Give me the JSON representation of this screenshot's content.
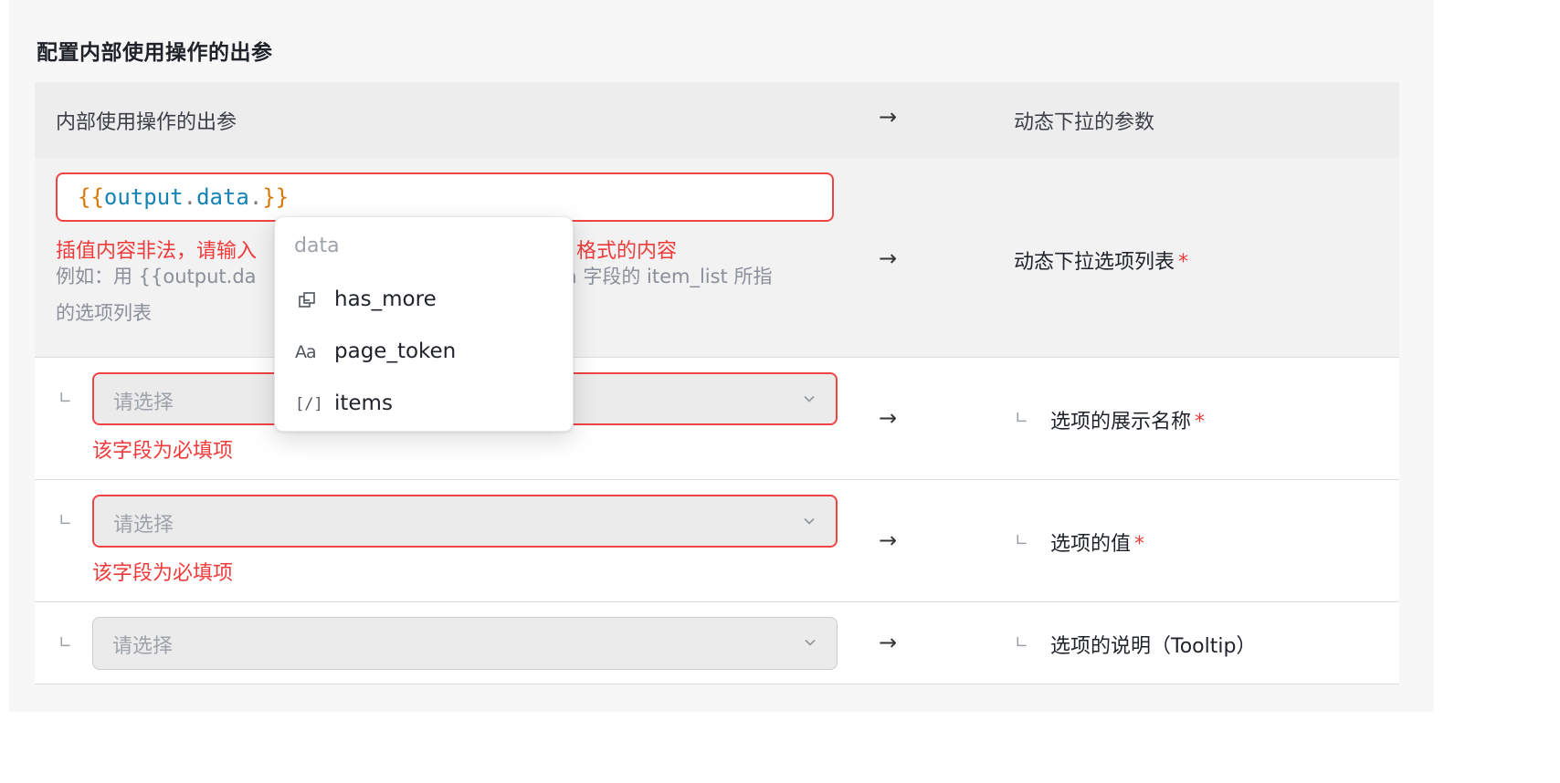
{
  "section_title": "配置内部使用操作的出参",
  "table": {
    "header_left": "内部使用操作的出参",
    "header_arrow": "→",
    "header_right": "动态下拉的参数"
  },
  "row_expression": {
    "input_value": "{{output.data.}}",
    "tokens": {
      "open": "{{",
      "output": "output",
      "dot1": ".",
      "data": "data",
      "dot2": ".",
      "close": "}}"
    },
    "error_prefix": "插值内容非法，请输入",
    "error_suffix": "格式的内容",
    "hint_line1_start": "例如：用 {{output.da",
    "hint_line1_end": "ta 字段的 item_list 所指",
    "hint_line2": "的选项列表",
    "arrow": "→",
    "target_label": "动态下拉选项列表",
    "required": "*"
  },
  "rows": [
    {
      "tree_mark": "∟",
      "placeholder": "请选择",
      "error": "该字段为必填项",
      "arrow": "→",
      "target_tree_mark": "∟",
      "target_label": "选项的展示名称",
      "required": "*"
    },
    {
      "tree_mark": "∟",
      "placeholder": "请选择",
      "error": "该字段为必填项",
      "arrow": "→",
      "target_tree_mark": "∟",
      "target_label": "选项的值",
      "required": "*"
    },
    {
      "tree_mark": "∟",
      "placeholder": "请选择",
      "error": "",
      "arrow": "→",
      "target_tree_mark": "∟",
      "target_label": "选项的说明（Tooltip）",
      "required": ""
    }
  ],
  "dropdown": {
    "title": "data",
    "items": [
      {
        "icon": "object-icon",
        "label": "has_more"
      },
      {
        "icon": "string-icon",
        "glyph": "Aa",
        "label": "page_token"
      },
      {
        "icon": "array-icon",
        "glyph": "[/]",
        "label": "items"
      }
    ]
  },
  "colors": {
    "error": "#ef3b3b",
    "brace_token": "#d97706",
    "ident_token": "#1482b5"
  }
}
